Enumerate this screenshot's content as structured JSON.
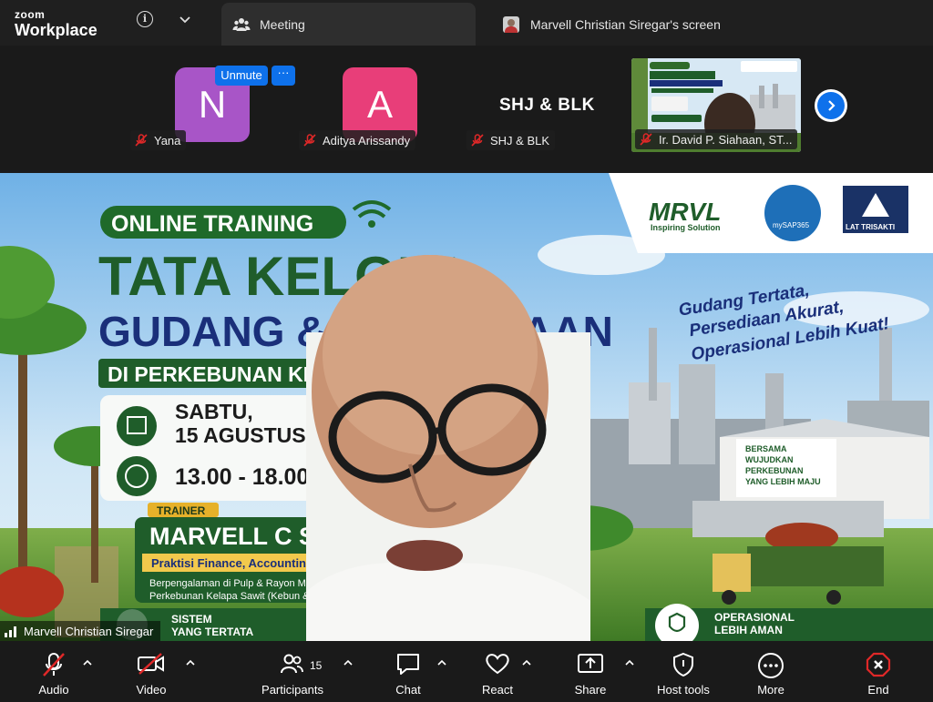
{
  "titlebar": {
    "brand_small": "zoom",
    "brand_large": "Workplace",
    "tabs": [
      {
        "label": "Meeting"
      },
      {
        "label": "Marvell Christian Siregar's screen"
      }
    ]
  },
  "gallery": {
    "participants": [
      {
        "initial": "N",
        "name": "Yana",
        "color": "#a855c7"
      },
      {
        "initial": "A",
        "name": "Aditya Arissandy",
        "color": "#e83e79"
      },
      {
        "initial": "",
        "name": "SHJ & BLK",
        "display_text": "SHJ & BLK"
      },
      {
        "initial": "",
        "name": "Ir. David P. Siahaan, ST..."
      }
    ],
    "unmute_label": "Unmute",
    "more_label": "···"
  },
  "share": {
    "presenter_label": "Marvell Christian Siregar",
    "slide": {
      "badge": "ONLINE TRAINING",
      "title_line1": "TATA KELOLA",
      "title_line2": "GUDANG & PERSEDIAAN",
      "title_line3": "DI PERKEBUNAN KELAPA SAWIT",
      "date_day": "SABTU,",
      "date_full": "15 AGUSTUS 2026",
      "time": "13.00 - 18.00 WIB",
      "trainer_tag": "TRAINER",
      "trainer_name": "MARVELL C SIREGAR",
      "trainer_role": "Praktisi Finance, Accounting",
      "trainer_desc1": "Berpengalaman di Pulp & Rayon Mill, Fo",
      "trainer_desc2": "Perkebunan Kelapa Sawit (Kebun & Pabri",
      "tagline1": "Gudang Tertata,",
      "tagline2": "Persediaan Akurat,",
      "tagline3": "Operasional Lebih Kuat!",
      "logo1": "MRVL",
      "logo1_sub": "Inspiring Solution",
      "logo2": "mySAP365",
      "logo3": "LAT TRISAKTI",
      "sign1": "BERSAMA",
      "sign2": "WUJUDKAN",
      "sign3": "PERKEBUNAN",
      "sign4": "YANG LEBIH MAJU",
      "feature1_a": "SISTEM",
      "feature1_b": "YANG TERTATA",
      "feature2_a": "OPERASIONAL",
      "feature2_b": "LEBIH AMAN"
    }
  },
  "toolbar": {
    "audio": "Audio",
    "video": "Video",
    "participants": "Participants",
    "participants_count": "15",
    "chat": "Chat",
    "react": "React",
    "share": "Share",
    "host_tools": "Host tools",
    "more": "More",
    "end": "End"
  },
  "colors": {
    "accent": "#0e71eb",
    "end_red": "#e02828",
    "mute_red": "#e02828"
  }
}
